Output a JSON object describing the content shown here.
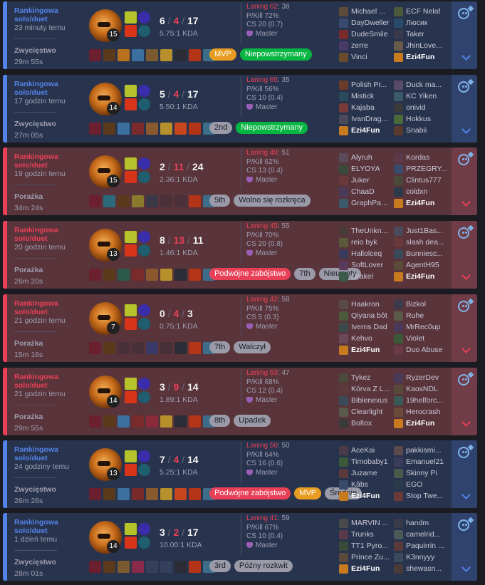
{
  "matches": [
    {
      "outcome": "win",
      "queue": "Rankingowa solo/duet",
      "time_ago": "23 minuty temu",
      "result": "Zwycięstwo",
      "duration": "29m 55s",
      "level": "15",
      "kills": "6",
      "deaths": "4",
      "assists": "17",
      "kda": "5.75:1 KDA",
      "items": [
        "#6b1f2f",
        "#5a3a1a",
        "#b8721f",
        "#3b6f9e",
        "#7a5a2e",
        "#b7902c",
        "#2c2c36",
        "#b43417",
        "#3c6e8a"
      ],
      "tags": [
        {
          "text": "MVP",
          "style": "mvp"
        },
        {
          "text": "Niepowstrzymany",
          "style": "green"
        }
      ],
      "laning_label": "Laning 62",
      "laning_value": ": 38",
      "pkill": "P/Kill 72%",
      "cs": "CS 20 (0.7)",
      "tier": "Master",
      "team1": [
        {
          "name": "Michael ...",
          "color": "#5e4a3a"
        },
        {
          "name": "DayDweller",
          "color": "#3a4a6e"
        },
        {
          "name": "DudeSmile",
          "color": "#7a2a2a"
        },
        {
          "name": "zerre",
          "color": "#4a3a6a"
        },
        {
          "name": "Vinci",
          "color": "#6a4a2a"
        }
      ],
      "team2": [
        {
          "name": "ECF Nelaf",
          "color": "#4a5a3a"
        },
        {
          "name": "Люсик",
          "color": "#2a4a6a"
        },
        {
          "name": "Taker",
          "color": "#3a3a4a"
        },
        {
          "name": "JhinLove...",
          "color": "#6a5a4a"
        },
        {
          "name": "Ezi4Fun",
          "color": "#c87a1e",
          "me": true
        }
      ]
    },
    {
      "outcome": "win",
      "queue": "Rankingowa solo/duet",
      "time_ago": "17 godzin temu",
      "result": "Zwycięstwo",
      "duration": "27m 05s",
      "level": "14",
      "kills": "5",
      "deaths": "4",
      "assists": "17",
      "kda": "5.50:1 KDA",
      "items": [
        "#6b1f2f",
        "#5a3a1a",
        "#3b6f9e",
        "#7a2a2a",
        "#8a5a2e",
        "#b7902c",
        "#c8461e",
        "#b43417",
        "#3c6e8a"
      ],
      "tags": [
        {
          "text": "2nd",
          "style": "grey"
        },
        {
          "text": "Niepowstrzymany",
          "style": "green"
        }
      ],
      "laning_label": "Laning 65",
      "laning_value": ": 35",
      "pkill": "P/Kill 56%",
      "cs": "CS 10 (0.4)",
      "tier": "Master",
      "team1": [
        {
          "name": "Polish Pr...",
          "color": "#6a3a2a"
        },
        {
          "name": "Mistick",
          "color": "#2a4a5a"
        },
        {
          "name": "Kajaba",
          "color": "#7a3a3a"
        },
        {
          "name": "IvanDrag...",
          "color": "#4a4a5a"
        },
        {
          "name": "Ezi4Fun",
          "color": "#c87a1e",
          "me": true
        }
      ],
      "team2": [
        {
          "name": "Duck ma...",
          "color": "#5a4a6a"
        },
        {
          "name": "KC Yiken",
          "color": "#3a5a6a"
        },
        {
          "name": "onivid",
          "color": "#3a3a3a"
        },
        {
          "name": "Hokkus",
          "color": "#4a6a3a"
        },
        {
          "name": "Snabii",
          "color": "#5a3a2a"
        }
      ]
    },
    {
      "outcome": "loss",
      "queue": "Rankingowa solo/duet",
      "time_ago": "19 godzin temu",
      "result": "Porażka",
      "duration": "34m 24s",
      "level": "15",
      "kills": "2",
      "deaths": "11",
      "assists": "24",
      "kda": "2.36:1 KDA",
      "items": [
        "#6b1f2f",
        "#2a6a7a",
        "#5a3a1a",
        "#8a7a2e",
        "#3a3a46",
        "#4a3038",
        "#4a3038",
        "#b43417",
        "#3c6e8a"
      ],
      "tags": [
        {
          "text": "5th",
          "style": "grey"
        },
        {
          "text": "Wolno się rozkręca",
          "style": "grey"
        }
      ],
      "laning_label": "Laning 49",
      "laning_value": ": 51",
      "pkill": "P/Kill 62%",
      "cs": "CS 13 (0.4)",
      "tier": "Master",
      "team1": [
        {
          "name": "Alyruh",
          "color": "#5a4a5a"
        },
        {
          "name": "ELYOYA",
          "color": "#3a4a3a"
        },
        {
          "name": "Juker",
          "color": "#6a3a3a"
        },
        {
          "name": "ChaaD",
          "color": "#4a3a5a"
        },
        {
          "name": "GraphPa...",
          "color": "#3a5a6a"
        }
      ],
      "team2": [
        {
          "name": "Kordas",
          "color": "#5a3a4a"
        },
        {
          "name": "PRZEGRY...",
          "color": "#3a4a6a"
        },
        {
          "name": "Clintus777",
          "color": "#4a4a3a"
        },
        {
          "name": "coldxn",
          "color": "#2a3a4a"
        },
        {
          "name": "Ezi4Fun",
          "color": "#c87a1e",
          "me": true
        }
      ]
    },
    {
      "outcome": "loss",
      "queue": "Rankingowa solo/duet",
      "time_ago": "20 godzin temu",
      "result": "Porażka",
      "duration": "26m 20s",
      "level": "13",
      "kills": "8",
      "deaths": "13",
      "assists": "11",
      "kda": "1.46:1 KDA",
      "items": [
        "#6b1f2f",
        "#5a3a1a",
        "#2a5a4a",
        "#7a2a2a",
        "#8a5a2e",
        "#b7902c",
        "#2c2c36",
        "#b43417",
        "#3c6e8a"
      ],
      "tags": [
        {
          "text": "Podwójne zabójstwo",
          "style": "red"
        },
        {
          "text": "7th",
          "style": "grey"
        },
        {
          "text": "Nieugięty",
          "style": "grey"
        }
      ],
      "laning_label": "Laning 45",
      "laning_value": ": 55",
      "pkill": "P/Kill 70%",
      "cs": "CS 20 (0.8)",
      "tier": "Master",
      "team1": [
        {
          "name": "TheUnkn...",
          "color": "#4a3a3a"
        },
        {
          "name": "reio byk",
          "color": "#5a5a3a"
        },
        {
          "name": "Hallolceq",
          "color": "#3a3a5a"
        },
        {
          "name": "SoftLover",
          "color": "#5a3a5a"
        },
        {
          "name": "Orakel",
          "color": "#3a5a4a"
        }
      ],
      "team2": [
        {
          "name": "Just1Bas...",
          "color": "#4a4a5a"
        },
        {
          "name": "slash dea...",
          "color": "#6a3a3a"
        },
        {
          "name": "Bunniesc...",
          "color": "#3a4a5a"
        },
        {
          "name": "AgentH95",
          "color": "#5a4a3a"
        },
        {
          "name": "Ezi4Fun",
          "color": "#c87a1e",
          "me": true
        }
      ]
    },
    {
      "outcome": "loss",
      "queue": "Rankingowa solo/duet",
      "time_ago": "21 godzin temu",
      "result": "Porażka",
      "duration": "15m 16s",
      "level": "7",
      "kills": "0",
      "deaths": "4",
      "assists": "3",
      "kda": "0.75:1 KDA",
      "items": [
        "#6b1f2f",
        "#5a3a1a",
        "#4a3038",
        "#4a3038",
        "#3a3a6a",
        "#4a3038",
        "#2c2c36",
        "#b43417",
        "#3c6e8a"
      ],
      "tags": [
        {
          "text": "7th",
          "style": "grey"
        },
        {
          "text": "Walczył",
          "style": "grey"
        }
      ],
      "laning_label": "Laning 42",
      "laning_value": ": 58",
      "pkill": "P/Kill 75%",
      "cs": "CS 5 (0.3)",
      "tier": "Master",
      "team1": [
        {
          "name": "Haakron",
          "color": "#5a4a4a"
        },
        {
          "name": "Qiyana bôt",
          "color": "#4a5a3a"
        },
        {
          "name": "Iverns Dad",
          "color": "#3a4a4a"
        },
        {
          "name": "Kehvo",
          "color": "#6a4a5a"
        },
        {
          "name": "Ezi4Fun",
          "color": "#c87a1e",
          "me": true
        }
      ],
      "team2": [
        {
          "name": "Bizkol",
          "color": "#3a3a4a"
        },
        {
          "name": "Ruhe",
          "color": "#5a5a4a"
        },
        {
          "name": "MrRec0up",
          "color": "#4a3a5a"
        },
        {
          "name": "Violet",
          "color": "#3a5a3a"
        },
        {
          "name": "Duo Abuse",
          "color": "#6a3a4a"
        }
      ]
    },
    {
      "outcome": "loss",
      "queue": "Rankingowa solo/duet",
      "time_ago": "21 godzin temu",
      "result": "Porażka",
      "duration": "29m 55s",
      "level": "14",
      "kills": "3",
      "deaths": "9",
      "assists": "14",
      "kda": "1.89:1 KDA",
      "items": [
        "#6b1f2f",
        "#5a3a1a",
        "#3b6f9e",
        "#7a2a2a",
        "#8a2a3a",
        "#b7902c",
        "#2c2c36",
        "#b43417",
        "#3c6e8a"
      ],
      "tags": [
        {
          "text": "8th",
          "style": "grey"
        },
        {
          "text": "Upadek",
          "style": "grey"
        }
      ],
      "laning_label": "Laning 53",
      "laning_value": ": 47",
      "pkill": "P/Kill 68%",
      "cs": "CS 12 (0.4)",
      "tier": "Master",
      "team1": [
        {
          "name": "Tykez",
          "color": "#4a4a3a"
        },
        {
          "name": "Kórva Z L...",
          "color": "#5a3a3a"
        },
        {
          "name": "Biblenexus",
          "color": "#3a4a5a"
        },
        {
          "name": "Clearlight",
          "color": "#5a5a4a"
        },
        {
          "name": "Boltox",
          "color": "#3a3a3a"
        }
      ],
      "team2": [
        {
          "name": "RyzerDev",
          "color": "#4a3a5a"
        },
        {
          "name": "KaosNDL",
          "color": "#5a4a3a"
        },
        {
          "name": "19helforc...",
          "color": "#3a5a5a"
        },
        {
          "name": "Herocrash",
          "color": "#6a4a3a"
        },
        {
          "name": "Ezi4Fun",
          "color": "#c87a1e",
          "me": true
        }
      ]
    },
    {
      "outcome": "win",
      "queue": "Rankingowa solo/duet",
      "time_ago": "24 godziny temu",
      "result": "Zwycięstwo",
      "duration": "26m 26s",
      "level": "13",
      "kills": "7",
      "deaths": "4",
      "assists": "14",
      "kda": "5.25:1 KDA",
      "items": [
        "#6b1f2f",
        "#5a3a1a",
        "#3b6f9e",
        "#7a2a2a",
        "#8a5a2e",
        "#b7902c",
        "#c8461e",
        "#b43417",
        "#3c6e8a"
      ],
      "tags": [
        {
          "text": "Podwójne zabójstwo",
          "style": "red"
        },
        {
          "text": "MVP",
          "style": "mvp"
        },
        {
          "text": "Średnie",
          "style": "grey"
        }
      ],
      "laning_label": "Laning 50",
      "laning_value": ": 50",
      "pkill": "P/Kill 64%",
      "cs": "CS 16 (0.6)",
      "tier": "Master",
      "team1": [
        {
          "name": "AceKai",
          "color": "#4a3a4a"
        },
        {
          "name": "Timobaby1",
          "color": "#3a5a3a"
        },
        {
          "name": "Juzame",
          "color": "#5a3a3a"
        },
        {
          "name": "Kâbs",
          "color": "#3a4a6a"
        },
        {
          "name": "Ezi4Fun",
          "color": "#c87a1e",
          "me": true
        }
      ],
      "team2": [
        {
          "name": "pakkismi...",
          "color": "#5a4a4a"
        },
        {
          "name": "Emanuel21",
          "color": "#3a3a5a"
        },
        {
          "name": "Skinny Pi",
          "color": "#4a5a4a"
        },
        {
          "name": "EGO",
          "color": "#2a3a4a"
        },
        {
          "name": "Stop Twe...",
          "color": "#6a3a3a"
        }
      ]
    },
    {
      "outcome": "win",
      "queue": "Rankingowa solo/duet",
      "time_ago": "1 dzień temu",
      "result": "Zwycięstwo",
      "duration": "28m 01s",
      "level": "14",
      "kills": "3",
      "deaths": "2",
      "assists": "17",
      "kda": "10.00:1 KDA",
      "items": [
        "#6b1f2f",
        "#5a3a1a",
        "#7a5a2e",
        "#8a2a4a",
        "#34405c",
        "#34405c",
        "#2c2c36",
        "#b43417",
        "#3c6e8a"
      ],
      "tags": [
        {
          "text": "3rd",
          "style": "grey"
        },
        {
          "text": "Późny rozkwit",
          "style": "grey"
        }
      ],
      "laning_label": "Laning 41",
      "laning_value": ": 59",
      "pkill": "P/Kill 67%",
      "cs": "CS 10 (0.4)",
      "tier": "Master",
      "team1": [
        {
          "name": "MARVIN ...",
          "color": "#4a4a4a"
        },
        {
          "name": "Trunks",
          "color": "#5a3a4a"
        },
        {
          "name": "TT1 Pyro...",
          "color": "#3a4a3a"
        },
        {
          "name": "Prince Zu...",
          "color": "#5a4a3a"
        },
        {
          "name": "Ezi4Fun",
          "color": "#c87a1e",
          "me": true
        }
      ],
      "team2": [
        {
          "name": "handm",
          "color": "#3a3a4a"
        },
        {
          "name": "camelrid...",
          "color": "#4a5a5a"
        },
        {
          "name": "Paquirrin ...",
          "color": "#5a3a3a"
        },
        {
          "name": "K3nnyyy",
          "color": "#3a4a5a"
        },
        {
          "name": "shewasn...",
          "color": "#4a3a3a"
        }
      ]
    }
  ]
}
